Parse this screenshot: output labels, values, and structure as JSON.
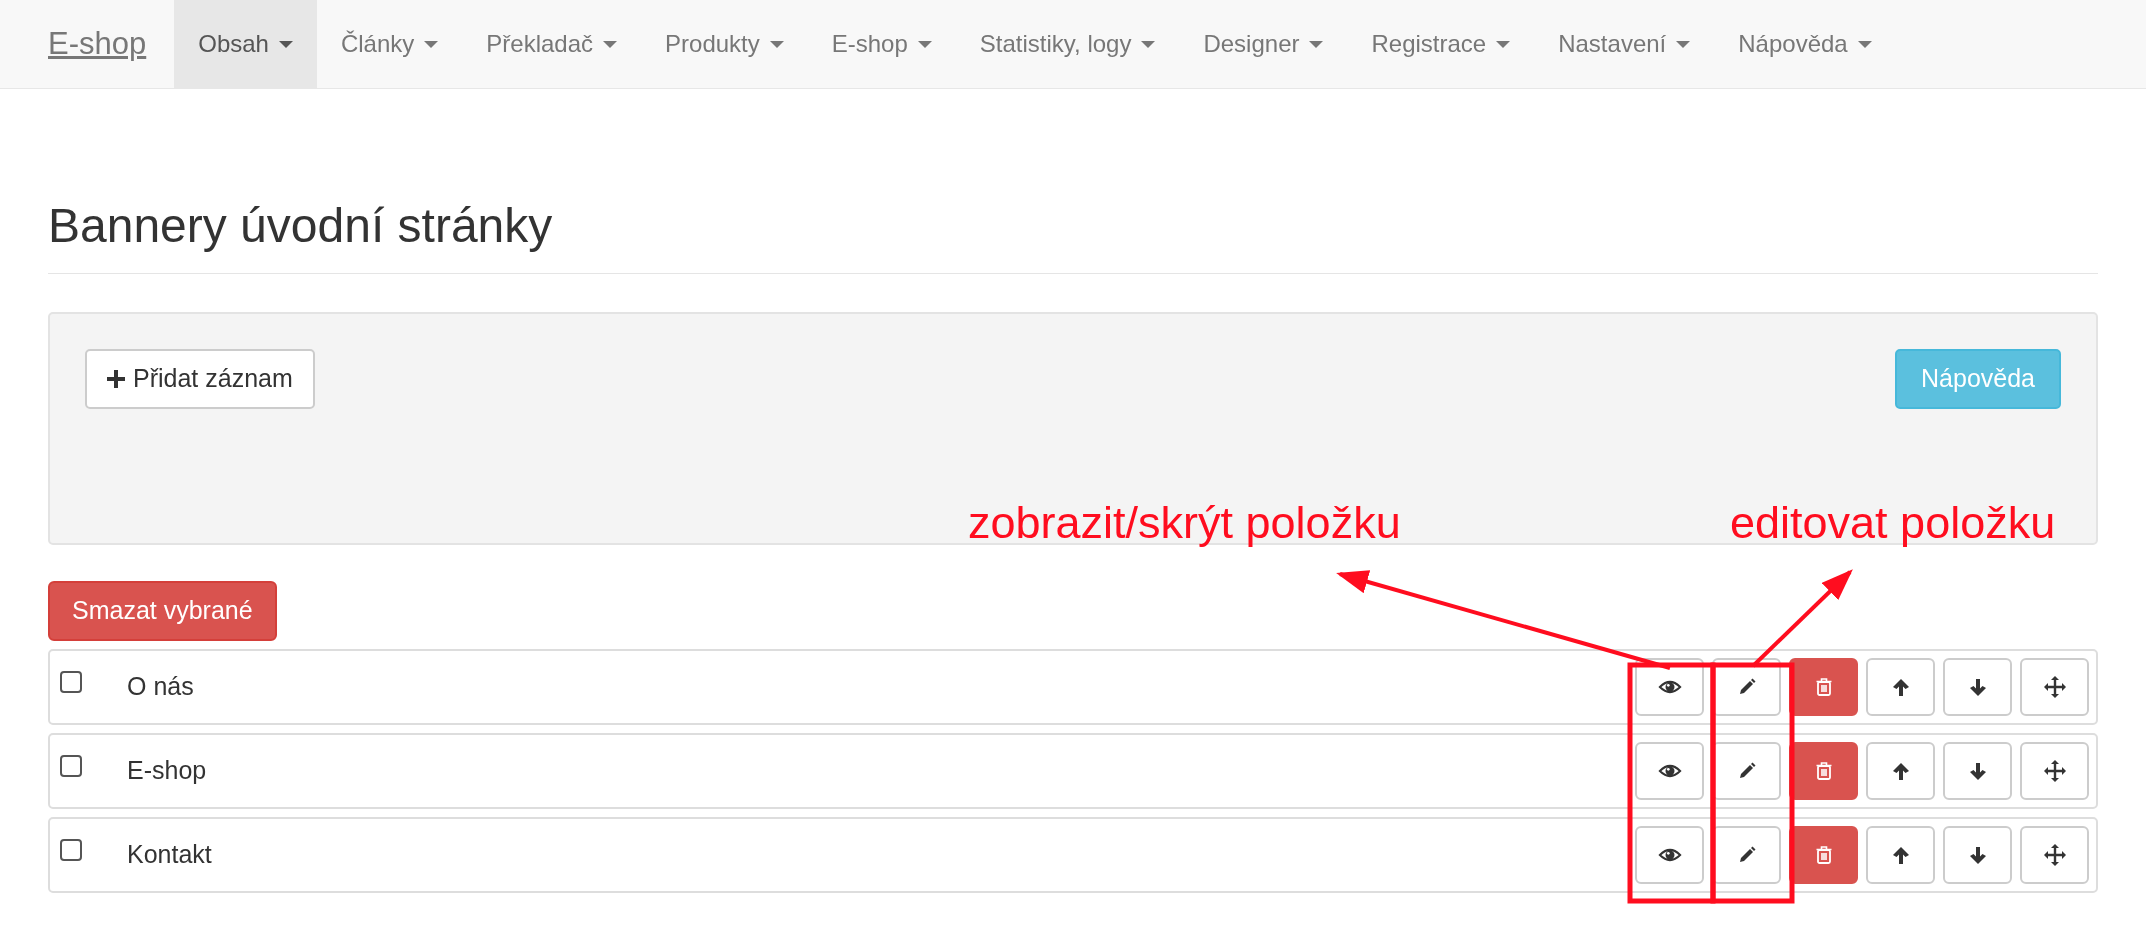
{
  "navbar": {
    "brand": "E-shop",
    "items": [
      {
        "label": "Obsah",
        "selected": true
      },
      {
        "label": "Články",
        "selected": false
      },
      {
        "label": "Překladač",
        "selected": false
      },
      {
        "label": "Produkty",
        "selected": false
      },
      {
        "label": "E-shop",
        "selected": false
      },
      {
        "label": "Statistiky, logy",
        "selected": false
      },
      {
        "label": "Designer",
        "selected": false
      },
      {
        "label": "Registrace",
        "selected": false
      },
      {
        "label": "Nastavení",
        "selected": false
      },
      {
        "label": "Nápověda",
        "selected": false
      }
    ]
  },
  "page_title": "Bannery úvodní stránky",
  "toolbar": {
    "add_button": "Přidat záznam",
    "help_button": "Nápověda"
  },
  "delete_selected_button": "Smazat vybrané",
  "row_actions": [
    {
      "kind": "show"
    },
    {
      "kind": "edit"
    },
    {
      "kind": "delete"
    },
    {
      "kind": "up"
    },
    {
      "kind": "down"
    },
    {
      "kind": "move"
    }
  ],
  "rows": [
    {
      "title": "O nás",
      "checked": false
    },
    {
      "title": "E-shop",
      "checked": false
    },
    {
      "title": "Kontakt",
      "checked": false
    }
  ],
  "annotations": [
    {
      "text": "zobrazit/skrýt položku"
    },
    {
      "text": "editovat položku"
    }
  ]
}
